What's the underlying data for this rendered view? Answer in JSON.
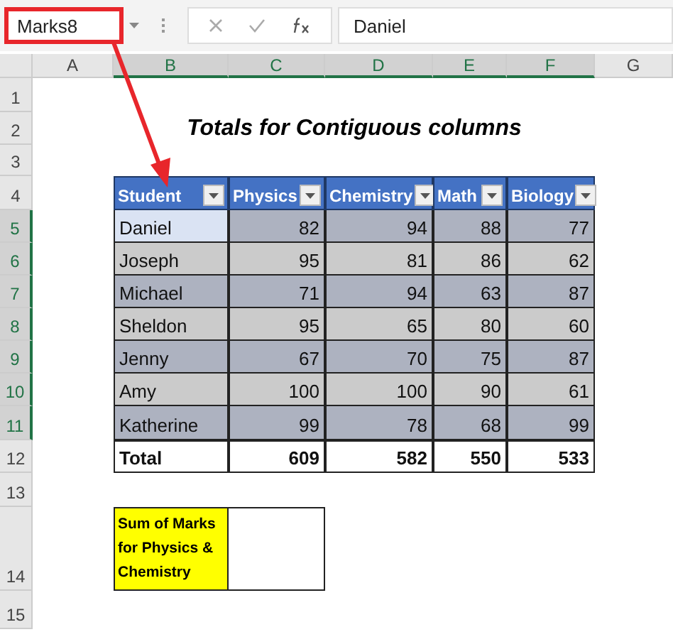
{
  "name_box": {
    "value": "Marks8",
    "highlighted": true
  },
  "formula_bar": {
    "value": "Daniel"
  },
  "columns": [
    {
      "label": "A",
      "selected": false
    },
    {
      "label": "B",
      "selected": true
    },
    {
      "label": "C",
      "selected": true
    },
    {
      "label": "D",
      "selected": true
    },
    {
      "label": "E",
      "selected": true
    },
    {
      "label": "F",
      "selected": true
    },
    {
      "label": "G",
      "selected": false
    }
  ],
  "rows": [
    {
      "label": "1",
      "selected": false
    },
    {
      "label": "2",
      "selected": false
    },
    {
      "label": "3",
      "selected": false
    },
    {
      "label": "4",
      "selected": false
    },
    {
      "label": "5",
      "selected": true
    },
    {
      "label": "6",
      "selected": true
    },
    {
      "label": "7",
      "selected": true
    },
    {
      "label": "8",
      "selected": true
    },
    {
      "label": "9",
      "selected": true
    },
    {
      "label": "10",
      "selected": true
    },
    {
      "label": "11",
      "selected": true
    },
    {
      "label": "12",
      "selected": false
    },
    {
      "label": "13",
      "selected": false
    },
    {
      "label": "14",
      "selected": false
    },
    {
      "label": "15",
      "selected": false
    }
  ],
  "title": "Totals for Contiguous columns",
  "table": {
    "columns": [
      "Student",
      "Physics",
      "Chemistry",
      "Math",
      "Biology"
    ],
    "rows": [
      {
        "cells": [
          "Daniel",
          "82",
          "94",
          "88",
          "77"
        ],
        "active": true
      },
      {
        "cells": [
          "Joseph",
          "95",
          "81",
          "86",
          "62"
        ],
        "active": false
      },
      {
        "cells": [
          "Michael",
          "71",
          "94",
          "63",
          "87"
        ],
        "active": false
      },
      {
        "cells": [
          "Sheldon",
          "95",
          "65",
          "80",
          "60"
        ],
        "active": false
      },
      {
        "cells": [
          "Jenny",
          "67",
          "70",
          "75",
          "87"
        ],
        "active": false
      },
      {
        "cells": [
          "Amy",
          "100",
          "100",
          "90",
          "61"
        ],
        "active": false
      },
      {
        "cells": [
          "Katherine",
          "99",
          "78",
          "68",
          "99"
        ],
        "active": false
      }
    ],
    "total": [
      "Total",
      "609",
      "582",
      "550",
      "533"
    ]
  },
  "sum_box": {
    "label": "Sum of Marks for Physics & Chemistry"
  }
}
